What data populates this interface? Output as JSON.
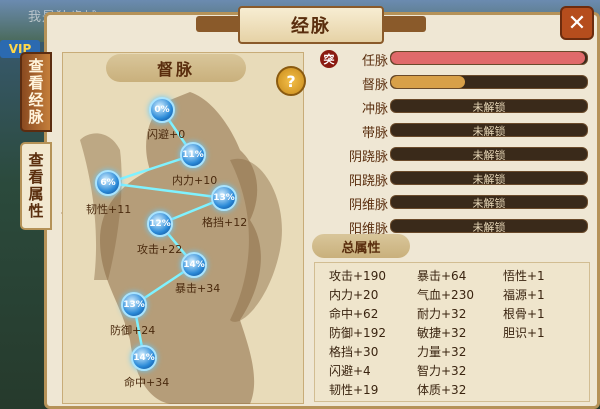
{
  "top_bar": {
    "text": "我是独步城"
  },
  "vip": {
    "label": "VIP"
  },
  "title": "经脉",
  "close_icon": "close-icon",
  "side_tabs": [
    {
      "label": "查看经脉"
    },
    {
      "label": "查看属性"
    }
  ],
  "left_panel": {
    "title": "督脉",
    "help": "?",
    "nodes": [
      {
        "percent": "0%",
        "label": "闪避+0"
      },
      {
        "percent": "11%",
        "label": "内力+10"
      },
      {
        "percent": "6%",
        "label": "韧性+11"
      },
      {
        "percent": "13%",
        "label": "格挡+12"
      },
      {
        "percent": "12%",
        "label": "攻击+22"
      },
      {
        "percent": "14%",
        "label": "暴击+34"
      },
      {
        "percent": "13%",
        "label": "防御+24"
      },
      {
        "percent": "14%",
        "label": "命中+34"
      }
    ]
  },
  "meridians": [
    {
      "name": "任脉",
      "badge": "突",
      "locked_text": "",
      "fill": 0.99,
      "color": "#e06a6a"
    },
    {
      "name": "督脉",
      "locked_text": "",
      "fill": 0.38,
      "color": "#d8a048"
    },
    {
      "name": "冲脉",
      "locked_text": "未解锁",
      "fill": 0
    },
    {
      "name": "带脉",
      "locked_text": "未解锁",
      "fill": 0
    },
    {
      "name": "阴跷脉",
      "locked_text": "未解锁",
      "fill": 0
    },
    {
      "name": "阳跷脉",
      "locked_text": "未解锁",
      "fill": 0
    },
    {
      "name": "阴维脉",
      "locked_text": "未解锁",
      "fill": 0
    },
    {
      "name": "阳维脉",
      "locked_text": "未解锁",
      "fill": 0
    }
  ],
  "attributes": {
    "title": "总属性",
    "col1": [
      "攻击+190",
      "内力+20",
      "命中+62",
      "防御+192",
      "格挡+30",
      "闪避+4",
      "韧性+19"
    ],
    "col2": [
      "暴击+64",
      "气血+230",
      "耐力+32",
      "敏捷+32",
      "力量+32",
      "智力+32",
      "体质+32"
    ],
    "col3": [
      "悟性+1",
      "福源+1",
      "根骨+1",
      "胆识+1"
    ]
  }
}
